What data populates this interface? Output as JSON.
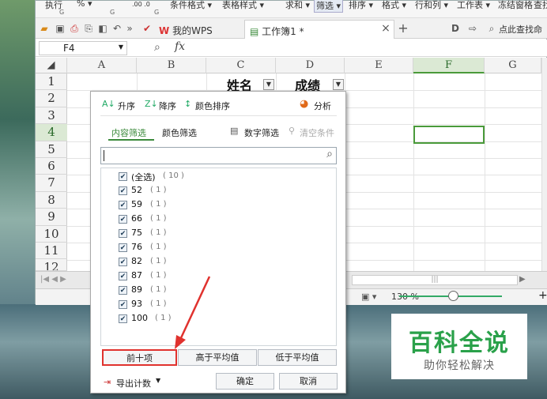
{
  "ribbon": {
    "items": [
      "执行",
      "% ▾",
      ".00 .0",
      "条件格式 ▾",
      "表格样式 ▾",
      "求和 ▾",
      "筛选 ▾",
      "排序 ▾",
      "格式 ▾",
      "行和列 ▾",
      "工作表 ▾",
      "冻结窗格",
      "查找"
    ],
    "subs": [
      "G",
      "G",
      "G"
    ]
  },
  "tabs": {
    "wps_tab": "我的WPS",
    "book_tab": "工作簿1 *",
    "close_glyph": "×",
    "add_glyph": "+",
    "search_hint": "点此查找命"
  },
  "formula_bar": {
    "cell_ref": "F4",
    "fx": "fx"
  },
  "grid": {
    "columns": [
      "A",
      "B",
      "C",
      "D",
      "E",
      "F",
      "G"
    ],
    "rows": [
      "1",
      "2",
      "3",
      "4",
      "5",
      "6",
      "7",
      "8",
      "9",
      "10",
      "11",
      "12"
    ],
    "header_name": "姓名",
    "header_score": "成绩",
    "selected_cell": "F4"
  },
  "status": {
    "zoom": "130 %",
    "minus": "–",
    "plus": "+"
  },
  "filter_panel": {
    "sort_asc": "升序",
    "sort_desc": "降序",
    "sort_color": "颜色排序",
    "analyze": "分析",
    "tab_content": "内容筛选",
    "tab_color": "颜色筛选",
    "number_filter": "数字筛选",
    "clear_filter": "清空条件",
    "search_placeholder": "",
    "items": [
      {
        "value": "(全选)",
        "count": "( 10 )"
      },
      {
        "value": "52",
        "count": "( 1 )"
      },
      {
        "value": "59",
        "count": "( 1 )"
      },
      {
        "value": "66",
        "count": "( 1 )"
      },
      {
        "value": "75",
        "count": "( 1 )"
      },
      {
        "value": "76",
        "count": "( 1 )"
      },
      {
        "value": "82",
        "count": "( 1 )"
      },
      {
        "value": "87",
        "count": "( 1 )"
      },
      {
        "value": "89",
        "count": "( 1 )"
      },
      {
        "value": "93",
        "count": "( 1 )"
      },
      {
        "value": "100",
        "count": "( 1 )"
      }
    ],
    "top_ten": "前十项",
    "above_avg": "高于平均值",
    "below_avg": "低于平均值",
    "export_count": "导出计数",
    "ok": "确定",
    "cancel": "取消"
  },
  "watermark": {
    "title": "百科全说",
    "subtitle": "助你轻松解决"
  },
  "colors": {
    "selection": "#4a9a3a",
    "highlight": "#e0322e",
    "accent_tab": "#3b8a3b",
    "watermark_green": "#2aa14a"
  }
}
